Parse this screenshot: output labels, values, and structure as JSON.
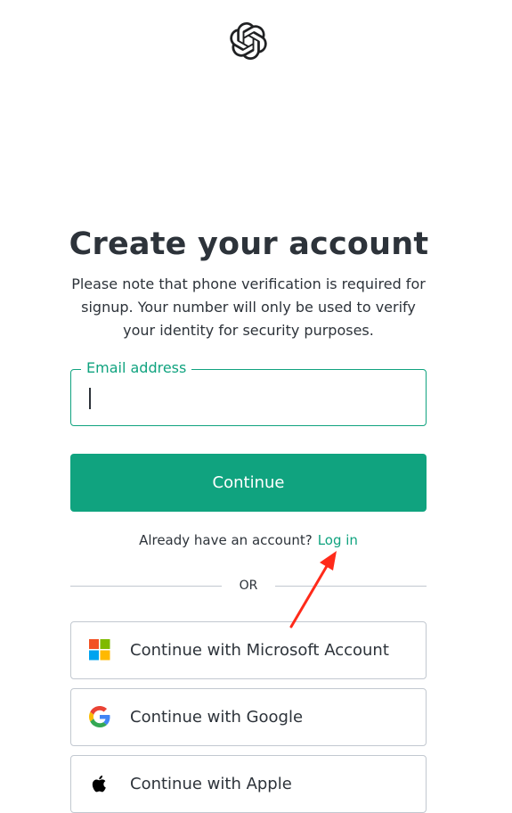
{
  "header": {
    "logo_icon": "openai-logo-icon"
  },
  "main": {
    "title": "Create your account",
    "subtitle": "Please note that phone verification is required for signup. Your number will only be used to verify your identity for security purposes.",
    "email": {
      "label": "Email address",
      "value": ""
    },
    "continue_label": "Continue",
    "login_prompt": "Already have an account?",
    "login_link": "Log in",
    "divider_text": "OR"
  },
  "social": {
    "microsoft_label": "Continue with Microsoft Account",
    "google_label": "Continue with Google",
    "apple_label": "Continue with Apple"
  },
  "annotation": {
    "arrow_icon": "red-arrow-icon",
    "color": "#ff2a1a"
  },
  "colors": {
    "accent": "#10a37f",
    "text": "#2d333a",
    "border": "#c2c8d0"
  }
}
